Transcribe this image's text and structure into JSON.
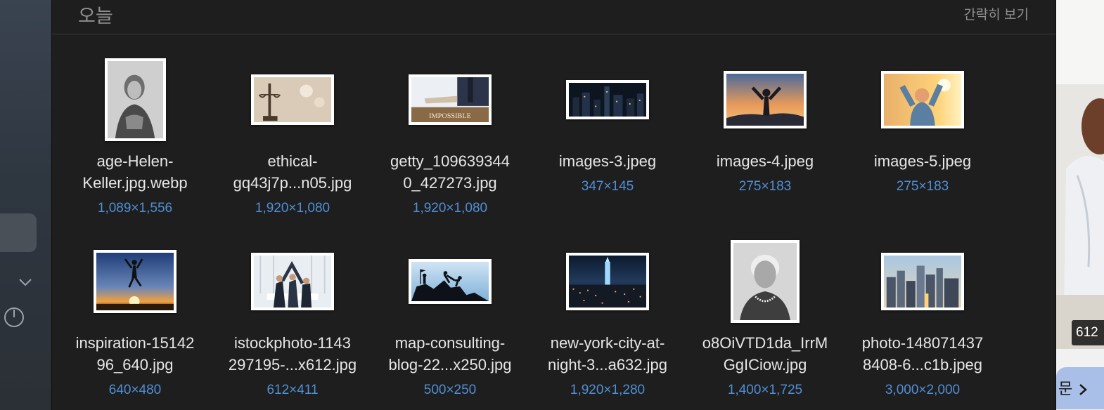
{
  "section": {
    "title": "오늘",
    "compact_view": "간략히 보기"
  },
  "right_panel": {
    "badge": "612",
    "button_label": "문",
    "button_icon": "chevron-right-icon"
  },
  "files": [
    {
      "name": "age-Helen-\nKeller.jpg.webp",
      "dims": "1,089×1,556"
    },
    {
      "name": "ethical-\ngq43j7p...n05.jpg",
      "dims": "1,920×1,080"
    },
    {
      "name": "getty_109639344\n0_427273.jpg",
      "dims": "1,920×1,080"
    },
    {
      "name": "images-3.jpeg",
      "dims": "347×145"
    },
    {
      "name": "images-4.jpeg",
      "dims": "275×183"
    },
    {
      "name": "images-5.jpeg",
      "dims": "275×183"
    },
    {
      "name": "inspiration-15142\n96_640.jpg",
      "dims": "640×480"
    },
    {
      "name": "istockphoto-1143\n297195-...x612.jpg",
      "dims": "612×411"
    },
    {
      "name": "map-consulting-\nblog-22...x250.jpg",
      "dims": "500×250"
    },
    {
      "name": "new-york-city-at-\nnight-3...a632.jpg",
      "dims": "1,920×1,280"
    },
    {
      "name": "o8OiVTD1da_IrrM\nGgICiow.jpg",
      "dims": "1,400×1,725"
    },
    {
      "name": "photo-148071437\n8408-6...c1b.jpeg",
      "dims": "3,000×2,000"
    }
  ],
  "thumbnail_text": {
    "impossible": "IMPOSSIBLE"
  }
}
